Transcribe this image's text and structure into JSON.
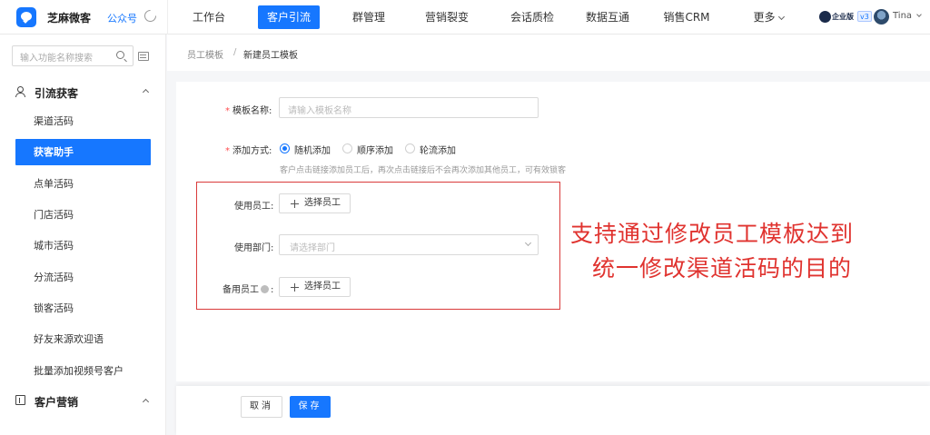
{
  "app": {
    "brand": "芝麻微客",
    "sub_brand": "公众号"
  },
  "topnav": {
    "items": [
      "工作台",
      "客户引流",
      "群管理",
      "营销裂变",
      "会话质检",
      "数据互通",
      "销售CRM",
      "更多"
    ],
    "active_index": 1
  },
  "account": {
    "edition": "企业版",
    "version_badge": "v3",
    "user": "Tina"
  },
  "sidebar": {
    "search_placeholder": "输入功能名称搜索",
    "groups": [
      {
        "title": "引流获客",
        "icon": "user-plus-icon",
        "items": [
          "渠道活码",
          "获客助手",
          "点单活码",
          "门店活码",
          "城市活码",
          "分流活码",
          "锁客活码",
          "好友来源欢迎语",
          "批量添加视频号客户"
        ],
        "active_index": 1
      },
      {
        "title": "客户营销",
        "icon": "doc-icon"
      }
    ]
  },
  "breadcrumb": {
    "parent": "员工模板",
    "separator": "/",
    "current": "新建员工模板"
  },
  "form": {
    "template_name": {
      "label": "模板名称:",
      "placeholder": "请输入模板名称"
    },
    "add_method": {
      "label": "添加方式:",
      "options": [
        "随机添加",
        "顺序添加",
        "轮流添加"
      ],
      "selected": "随机添加",
      "hint": "客户点击链接添加员工后，再次点击链接后不会再次添加其他员工，可有效锁客"
    },
    "employees": {
      "label": "使用员工:",
      "button": "选择员工"
    },
    "departments": {
      "label": "使用部门:",
      "placeholder": "请选择部门"
    },
    "backup_employees": {
      "label_prefix": "备用员工",
      "label_suffix": ":",
      "button": "选择员工"
    }
  },
  "annotation": {
    "line1": "支持通过修改员工模板达到",
    "line2": "统一修改渠道活码的目的"
  },
  "footer": {
    "cancel": "取消",
    "save": "保存"
  },
  "colors": {
    "primary": "#1677ff",
    "annotation": "#e0332f",
    "required": "#ff4d4f"
  }
}
